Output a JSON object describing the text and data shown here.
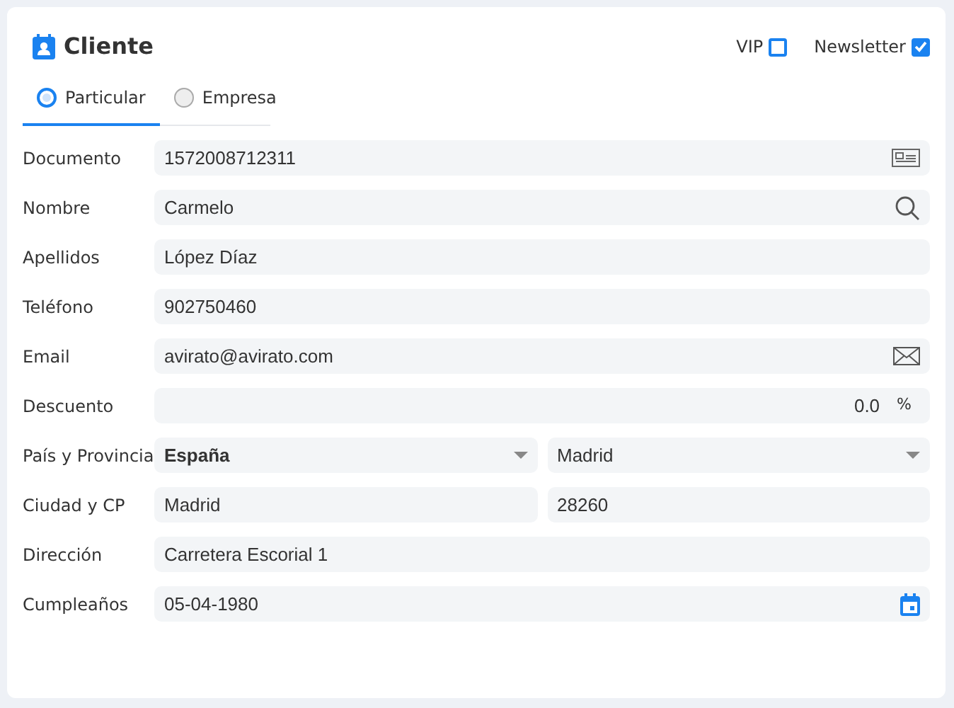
{
  "title": "Cliente",
  "options": [
    {
      "label": "VIP",
      "checked": false
    },
    {
      "label": "Newsletter",
      "checked": true
    }
  ],
  "tabs": [
    {
      "label": "Particular",
      "selected": true
    },
    {
      "label": "Empresa",
      "selected": false
    }
  ],
  "rows": [
    {
      "label": "Documento",
      "fields": [
        {
          "kind": "document",
          "value": "1572008712311"
        }
      ]
    },
    {
      "label": "Nombre",
      "fields": [
        {
          "kind": "search",
          "value": "Carmelo"
        }
      ]
    },
    {
      "label": "Apellidos",
      "fields": [
        {
          "kind": "text",
          "value": "López Díaz"
        }
      ]
    },
    {
      "label": "Teléfono",
      "fields": [
        {
          "kind": "text",
          "value": "902750460"
        }
      ]
    },
    {
      "label": "Email",
      "fields": [
        {
          "kind": "email",
          "value": "avirato@avirato.com"
        }
      ]
    },
    {
      "label": "Descuento",
      "fields": [
        {
          "kind": "number",
          "value": "0.0",
          "suffix": "%"
        }
      ]
    },
    {
      "label": "País y Provincia",
      "fields": [
        {
          "kind": "select",
          "value": "España",
          "bold": true
        },
        {
          "kind": "select",
          "value": "Madrid",
          "bold": false
        }
      ]
    },
    {
      "label": "Ciudad y CP",
      "fields": [
        {
          "kind": "text",
          "value": "Madrid"
        },
        {
          "kind": "text",
          "value": "28260"
        }
      ]
    },
    {
      "label": "Dirección",
      "fields": [
        {
          "kind": "text",
          "value": "Carretera Escorial 1"
        }
      ]
    },
    {
      "label": "Cumpleaños",
      "fields": [
        {
          "kind": "date",
          "value": "05-04-1980"
        }
      ]
    }
  ]
}
